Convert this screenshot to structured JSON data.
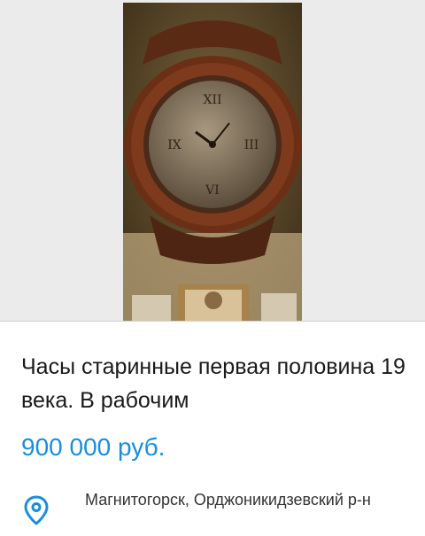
{
  "listing": {
    "photo": {
      "icon": "antique-clock-photo"
    },
    "title": "Часы старинные первая половина 19 века. В рабочим",
    "price": "900 000 руб.",
    "location": {
      "icon": "location-pin-icon",
      "text": "Магнитогорск, Орджоникидзевский р-н"
    }
  },
  "colors": {
    "price": "#1a8fd8",
    "pin": "#1a8fd8",
    "photo_background": "#ebebeb"
  }
}
